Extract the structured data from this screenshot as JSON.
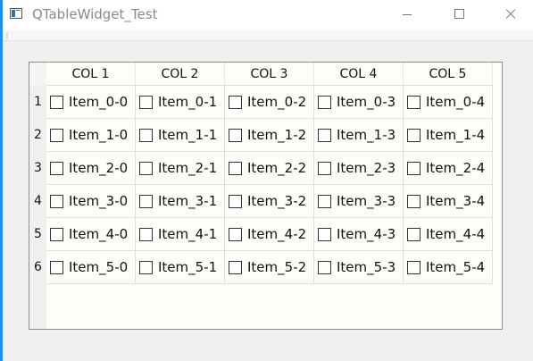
{
  "window": {
    "title": "QTableWidget_Test"
  },
  "table": {
    "columns": [
      "COL 1",
      "COL 2",
      "COL 3",
      "COL 4",
      "COL 5"
    ],
    "row_headers": [
      "1",
      "2",
      "3",
      "4",
      "5",
      "6"
    ],
    "rows": [
      [
        {
          "text": "Item_0-0",
          "checked": false
        },
        {
          "text": "Item_0-1",
          "checked": false
        },
        {
          "text": "Item_0-2",
          "checked": false
        },
        {
          "text": "Item_0-3",
          "checked": false
        },
        {
          "text": "Item_0-4",
          "checked": false
        }
      ],
      [
        {
          "text": "Item_1-0",
          "checked": false
        },
        {
          "text": "Item_1-1",
          "checked": false
        },
        {
          "text": "Item_1-2",
          "checked": false
        },
        {
          "text": "Item_1-3",
          "checked": false
        },
        {
          "text": "Item_1-4",
          "checked": false
        }
      ],
      [
        {
          "text": "Item_2-0",
          "checked": false
        },
        {
          "text": "Item_2-1",
          "checked": false
        },
        {
          "text": "Item_2-2",
          "checked": false
        },
        {
          "text": "Item_2-3",
          "checked": false
        },
        {
          "text": "Item_2-4",
          "checked": false
        }
      ],
      [
        {
          "text": "Item_3-0",
          "checked": false
        },
        {
          "text": "Item_3-1",
          "checked": false
        },
        {
          "text": "Item_3-2",
          "checked": false
        },
        {
          "text": "Item_3-3",
          "checked": false
        },
        {
          "text": "Item_3-4",
          "checked": false
        }
      ],
      [
        {
          "text": "Item_4-0",
          "checked": false
        },
        {
          "text": "Item_4-1",
          "checked": false
        },
        {
          "text": "Item_4-2",
          "checked": false
        },
        {
          "text": "Item_4-3",
          "checked": false
        },
        {
          "text": "Item_4-4",
          "checked": false
        }
      ],
      [
        {
          "text": "Item_5-0",
          "checked": false
        },
        {
          "text": "Item_5-1",
          "checked": false
        },
        {
          "text": "Item_5-2",
          "checked": false
        },
        {
          "text": "Item_5-3",
          "checked": false
        },
        {
          "text": "Item_5-4",
          "checked": false
        }
      ]
    ]
  }
}
